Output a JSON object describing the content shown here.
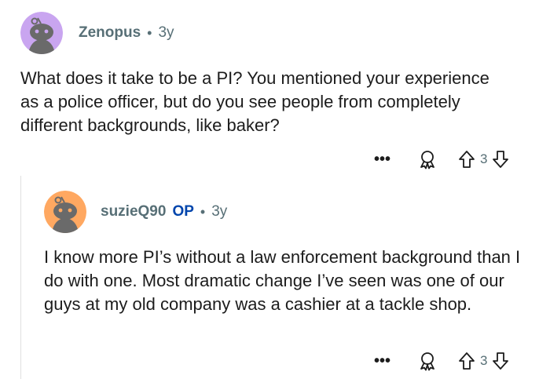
{
  "comments": [
    {
      "username": "Zenopus",
      "age": "3y",
      "separator": "•",
      "avatar_color": "#c9a5f0",
      "text": "What does it take to be a PI? You mentioned your experience as a police officer, but do you see people from completely different backgrounds, like baker?",
      "more_label": "•••",
      "vote_count": "3"
    },
    {
      "username": "suzieQ90",
      "op_badge": "OP",
      "age": "3y",
      "separator": "•",
      "avatar_color": "#ffa861",
      "text": "I know more PI’s without a law enforcement background than I do with one. Most dramatic change I’ve seen was one of our guys at my old company was a cashier at a tackle shop.",
      "more_label": "•••",
      "vote_count": "3"
    }
  ],
  "icons": {
    "avatar": "snoo-avatar-icon",
    "award": "award-icon",
    "upvote": "upvote-arrow-icon",
    "downvote": "downvote-arrow-icon"
  },
  "colors": {
    "username": "#576f76",
    "op_badge": "#0045ac",
    "text": "#1c1c1c"
  }
}
